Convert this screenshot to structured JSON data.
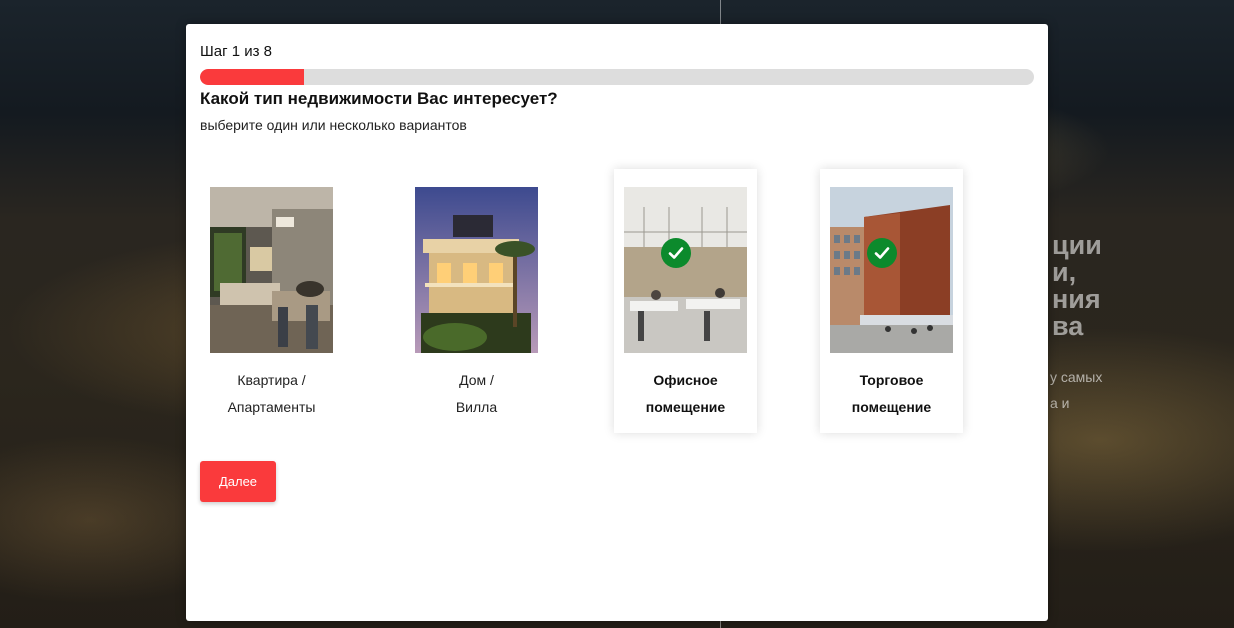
{
  "background": {
    "hero_lines": [
      "ции",
      "и,",
      "ния",
      "ва"
    ],
    "sub_lines": [
      "у самых",
      "а и"
    ]
  },
  "quiz": {
    "step_label": "Шаг 1 из 8",
    "progress_fraction": 0.125,
    "question": "Какой тип недвижимости Вас интересует?",
    "hint": "выберите один или несколько вариантов",
    "options": [
      {
        "line1": "Квартира /",
        "line2": "Апартаменты",
        "selected": false,
        "image_icon": "apartment-interior-photo"
      },
      {
        "line1": "Дом /",
        "line2": "Вилла",
        "selected": false,
        "image_icon": "villa-photo"
      },
      {
        "line1": "Офисное",
        "line2": "помещение",
        "selected": true,
        "image_icon": "office-photo"
      },
      {
        "line1": "Торговое",
        "line2": "помещение",
        "selected": true,
        "image_icon": "commercial-building-photo"
      }
    ],
    "next_label": "Далее"
  },
  "colors": {
    "accent": "#fa3a3c",
    "check": "#0c8a2c",
    "track": "#dddddd"
  }
}
